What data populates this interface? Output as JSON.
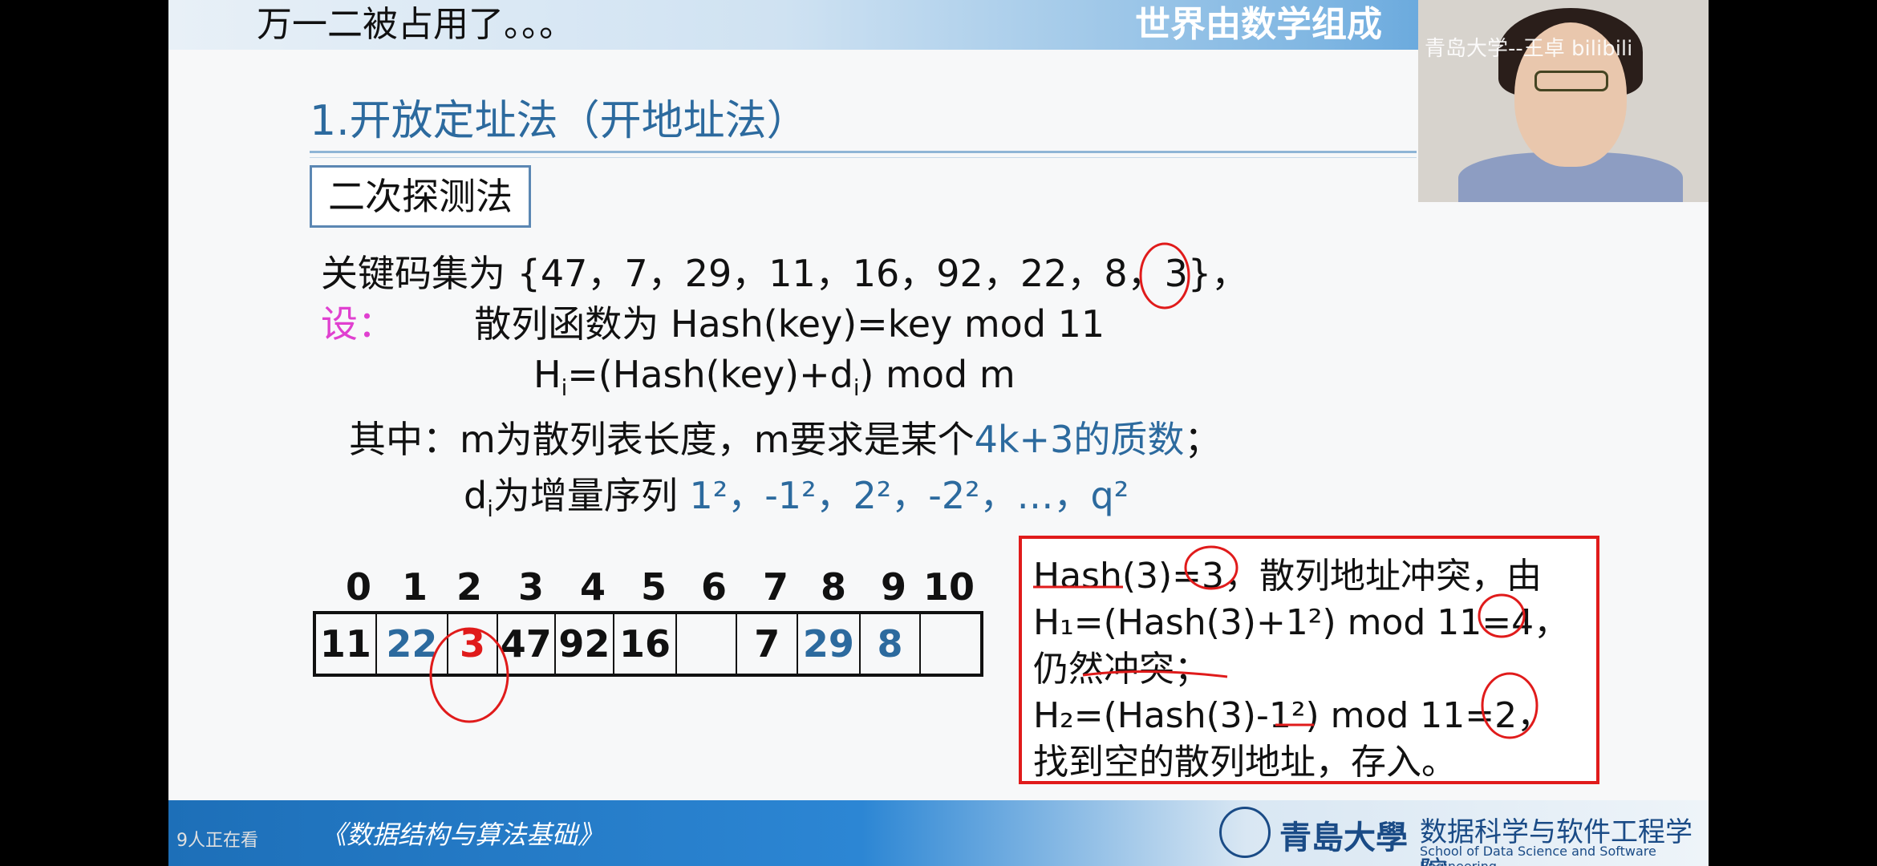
{
  "topbar": {
    "caption": "万一二被占用了。。。",
    "right_title": "世界由数学组成"
  },
  "camera": {
    "watermark": "青岛大学--王卓 bilibili"
  },
  "slide": {
    "title": "1.开放定址法（开地址法）",
    "method": "二次探测法",
    "keyset": "关键码集为 {47，7，29，11，16，92，22，8，3}，",
    "let_label": "设：",
    "hash_fn": "散列函数为  Hash(key)=key mod 11",
    "hi_formula_pre": "H",
    "hi_formula_sub": "i",
    "hi_formula_mid": "=(Hash(key)+d",
    "hi_formula_sub2": "i",
    "hi_formula_post": ") mod m",
    "where_text": "其中：m为散列表长度，m要求是某个",
    "where_blue": "4k+3的质数",
    "where_end": "；",
    "di_text": "为增量序列",
    "di_seq": "1²，-1²，2²，-2²，…，q²",
    "indices": [
      "0",
      "1",
      "2",
      "3",
      "4",
      "5",
      "6",
      "7",
      "8",
      "9",
      "10"
    ],
    "table_values": [
      "11",
      "22",
      "3",
      "47",
      "92",
      "16",
      "",
      "7",
      "29",
      "8",
      ""
    ],
    "example": {
      "line1": "Hash(3)=3，散列地址冲突，由",
      "line2": "H₁=(Hash(3)+1²) mod 11=4，",
      "line3": "仍然冲突；",
      "line4": "H₂=(Hash(3)-1²) mod 11=2，",
      "line5": "找到空的散列地址，存入。"
    }
  },
  "footer": {
    "course": "《数据结构与算法基础》",
    "viewers": "9人正在看",
    "university": "青島大學",
    "school_cn": "数据科学与软件工程学院",
    "school_en": "School of Data Science and Software Engineering"
  },
  "colors": {
    "accent_blue": "#2c6a9e",
    "annot_red": "#e01b1b",
    "pink": "#e040d0"
  }
}
